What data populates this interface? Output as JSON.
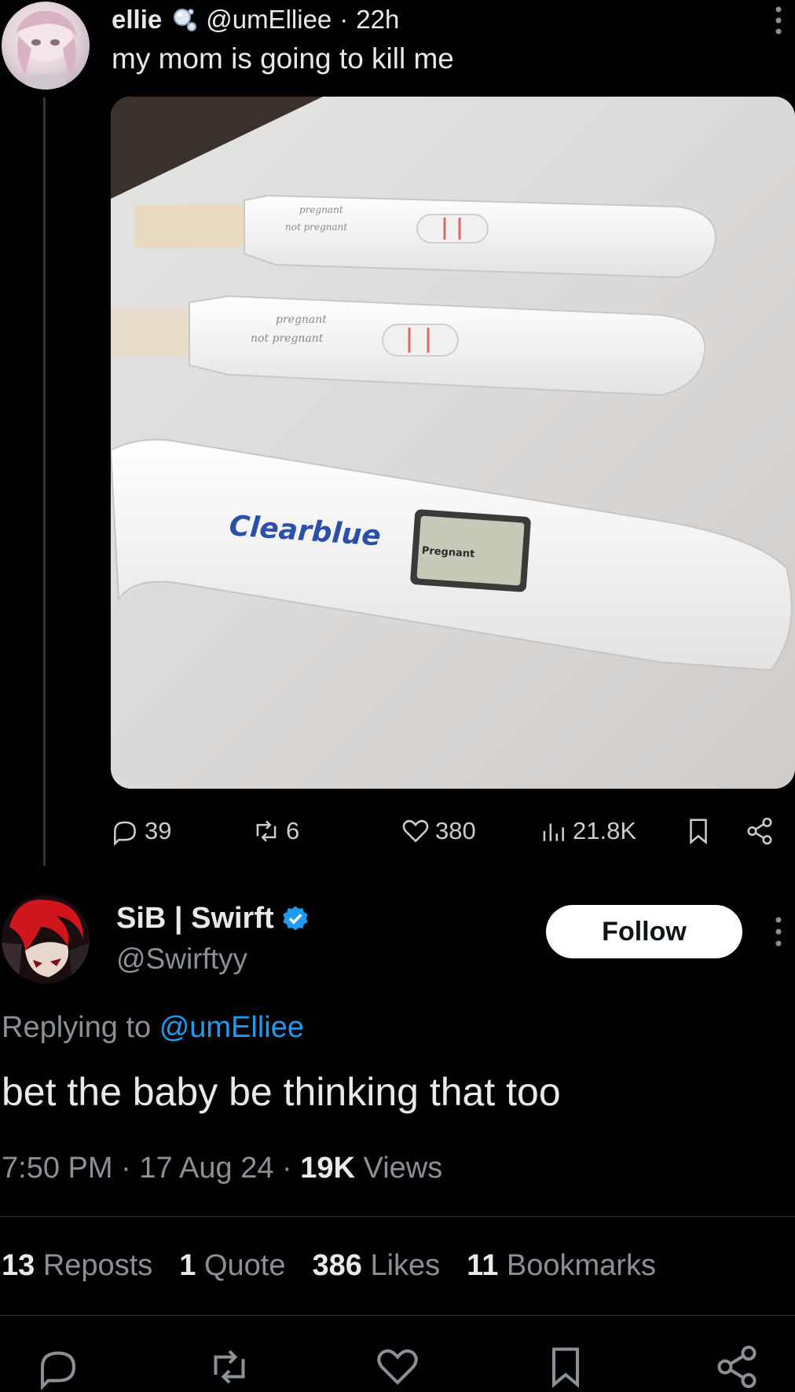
{
  "tweet": {
    "author_name": "ellie",
    "handle": "@umElliee",
    "separator": "·",
    "time": "22h",
    "text": "my mom is going to kill me",
    "photo": {
      "test1_label_top": "pregnant",
      "test1_label_bottom": "not pregnant",
      "test2_label_top": "pregnant",
      "test2_label_bottom": "not pregnant",
      "brand": "Clearblue",
      "display_text": "Pregnant"
    },
    "actions": {
      "replies": "39",
      "reposts": "6",
      "likes": "380",
      "views": "21.8K"
    }
  },
  "reply": {
    "author_name": "SiB | Swirft",
    "handle": "@Swirftyy",
    "follow_label": "Follow",
    "replying_prefix": "Replying to",
    "replying_mention": "@umElliee",
    "text": "bet the baby be thinking that too",
    "time": "7:50 PM",
    "date": "17 Aug 24",
    "views_count": "19K",
    "views_label": "Views",
    "dot": "·"
  },
  "stats": {
    "reposts_count": "13",
    "reposts_label": "Reposts",
    "quotes_count": "1",
    "quotes_label": "Quote",
    "likes_count": "386",
    "likes_label": "Likes",
    "bookmarks_count": "11",
    "bookmarks_label": "Bookmarks"
  },
  "colors": {
    "background": "#000000",
    "text": "#e7e9ea",
    "muted": "#8b9096",
    "link": "#1d9bf0",
    "verified": "#1d9bf0"
  }
}
